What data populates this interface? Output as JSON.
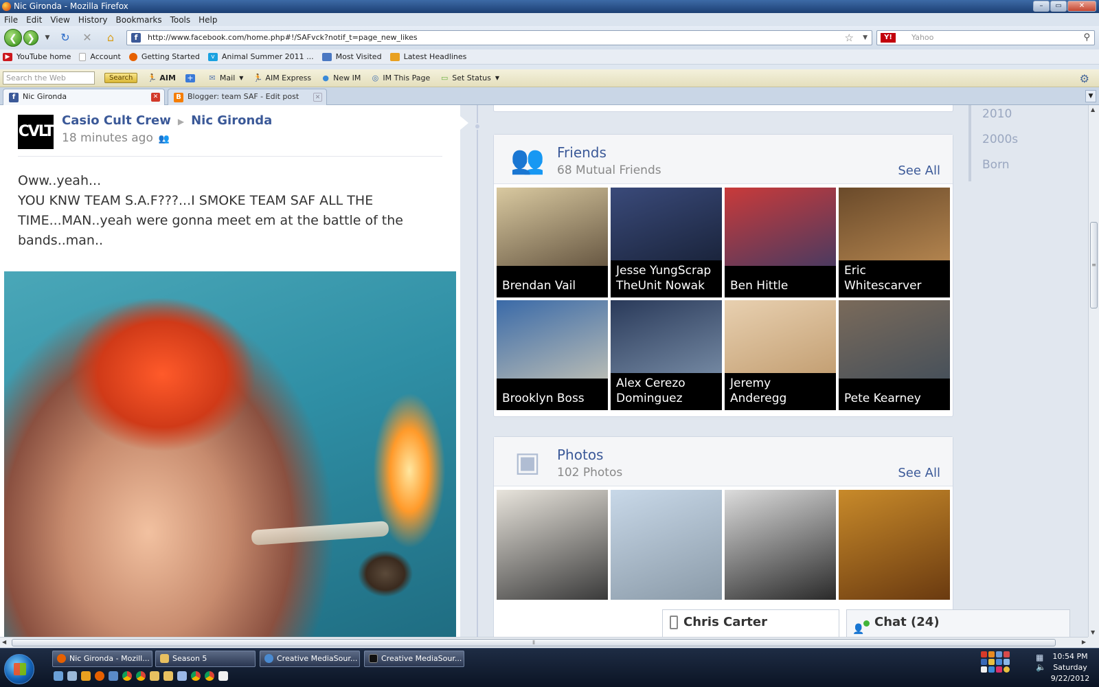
{
  "window": {
    "title": "Nic Gironda - Mozilla Firefox",
    "buttons": {
      "minimize": "–",
      "maximize": "▭",
      "close": "✕"
    }
  },
  "menu": [
    "File",
    "Edit",
    "View",
    "History",
    "Bookmarks",
    "Tools",
    "Help"
  ],
  "nav": {
    "url": "http://www.facebook.com/home.php#!/SAFvck?notif_t=page_new_likes",
    "search_placeholder": "Yahoo",
    "search_engine_icon": "Y!"
  },
  "bookmarks": [
    {
      "label": "YouTube home",
      "color": "#cc181e"
    },
    {
      "label": "Account",
      "color": "#ffffff"
    },
    {
      "label": "Getting Started",
      "color": "#e66000"
    },
    {
      "label": "Animal Summer 2011 ...",
      "color": "#1aa1e0"
    },
    {
      "label": "Most Visited",
      "color": "#4a78c2"
    },
    {
      "label": "Latest Headlines",
      "color": "#e8a020"
    }
  ],
  "aim_toolbar": {
    "search_placeholder": "Search the Web",
    "search_button": "Search",
    "items": [
      "AIM",
      "+",
      "Mail",
      "AIM Express",
      "New IM",
      "IM This Page",
      "Set Status"
    ]
  },
  "tabs": [
    {
      "label": "Nic Gironda",
      "active": true
    },
    {
      "label": "Blogger: team SAF - Edit post",
      "active": false
    }
  ],
  "post": {
    "avatar_text": "CVLT",
    "author": "Casio Cult Crew",
    "target": "Nic Gironda",
    "time": "18 minutes ago",
    "text_lines": [
      "Oww..yeah...",
      "YOU KNW TEAM S.A.F???...I SMOKE TEAM SAF ALL THE TIME...MAN..yeah were gonna meet em at the battle of the bands..man.."
    ]
  },
  "friends": {
    "title": "Friends",
    "subtitle": "68 Mutual Friends",
    "see_all": "See All",
    "items": [
      {
        "name": "Brendan Vail",
        "c1": "#d9c9a0",
        "c2": "#4a3a2a"
      },
      {
        "name": "Jesse YungScrap TheUnit Nowak",
        "c1": "#3a4a7a",
        "c2": "#101828"
      },
      {
        "name": "Ben Hittle",
        "c1": "#c93a3a",
        "c2": "#2a3a6a"
      },
      {
        "name": "Eric Whitescarver",
        "c1": "#6a4a2a",
        "c2": "#c9965a"
      },
      {
        "name": "Brooklyn Boss",
        "c1": "#3a6aa8",
        "c2": "#d8d0b8"
      },
      {
        "name": "Alex Cerezo Dominguez",
        "c1": "#2a3a5a",
        "c2": "#8aa0b8"
      },
      {
        "name": "Jeremy Anderegg",
        "c1": "#e8d0b0",
        "c2": "#b89060"
      },
      {
        "name": "Pete Kearney",
        "c1": "#7a6a5a",
        "c2": "#3a4a5a"
      }
    ]
  },
  "photos": {
    "title": "Photos",
    "subtitle": "102 Photos",
    "see_all": "See All",
    "items": [
      {
        "c1": "#e8e4dc",
        "c2": "#3a3a3a"
      },
      {
        "c1": "#c8d8e8",
        "c2": "#8a9aa8"
      },
      {
        "c1": "#dcdcdc",
        "c2": "#2a2a2a"
      },
      {
        "c1": "#c88a2a",
        "c2": "#6a3a10"
      }
    ]
  },
  "year_nav": [
    "2010",
    "2000s",
    "Born"
  ],
  "chat": {
    "contact": "Chris Carter",
    "label": "Chat (24)"
  },
  "taskbar": {
    "windows": [
      {
        "label": "Nic Gironda - Mozill...",
        "color": "#e66000"
      },
      {
        "label": "Season 5",
        "color": "#e8c060"
      },
      {
        "label": "Creative MediaSour...",
        "color": "#4a8ad0"
      },
      {
        "label": "Creative MediaSour...",
        "color": "#111111"
      }
    ],
    "clock": {
      "time": "10:54 PM",
      "day": "Saturday",
      "date": "9/22/2012"
    }
  }
}
